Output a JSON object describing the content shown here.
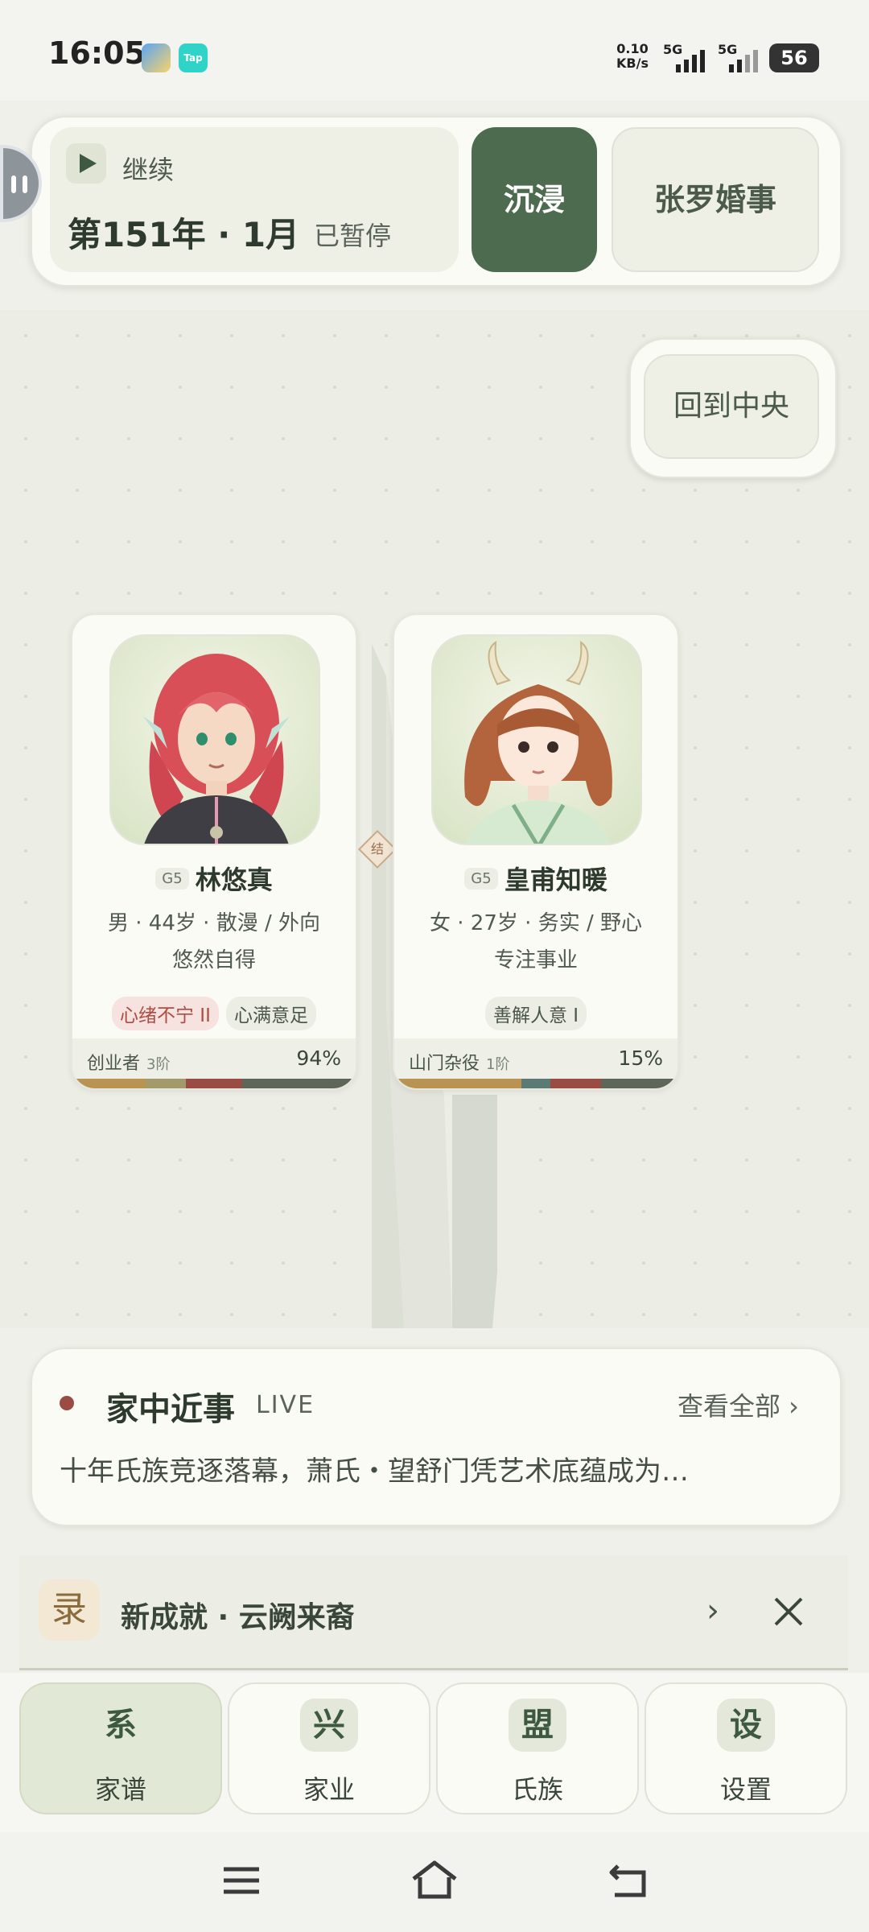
{
  "status_bar": {
    "time": "16:05",
    "app_icon_1": "Tap",
    "net_speed": "0.10",
    "net_unit": "KB/s",
    "sim1": "5G",
    "sim2": "5G",
    "battery": "56",
    "icons": [
      "app-icon-blue",
      "taptap-icon",
      "signal-icon",
      "battery-icon"
    ]
  },
  "top_bar": {
    "continue_label": "继续",
    "year_label": "第151年 · 1月",
    "paused_label": "已暂停",
    "immerse_button": "沉浸",
    "marriage_button": "张罗婚事"
  },
  "canvas": {
    "center_button": "回到中央",
    "marriage_knot": "结"
  },
  "members": [
    {
      "generation": "G5",
      "name": "林悠真",
      "info": "男 · 44岁 · 散漫 / 外向",
      "mood": "悠然自得",
      "tags": [
        {
          "label": "心绪不宁 II",
          "tone": "negative"
        },
        {
          "label": "心满意足",
          "tone": "neutral"
        }
      ],
      "job": "创业者",
      "job_level": "3阶",
      "progress": "94%",
      "progress_value": 0.94
    },
    {
      "generation": "G5",
      "name": "皇甫知暖",
      "info": "女 · 27岁 · 务实 / 野心",
      "mood": "专注事业",
      "tags": [
        {
          "label": "善解人意 I",
          "tone": "neutral"
        }
      ],
      "job": "山门杂役",
      "job_level": "1阶",
      "progress": "15%",
      "progress_value": 0.15
    }
  ],
  "news": {
    "title": "家中近事",
    "live": "LIVE",
    "view_all": "查看全部 ›",
    "text": "十年氏族竞逐落幕，萧氏・望舒门凭艺术底蕴成为…"
  },
  "achievement": {
    "icon_char": "录",
    "text": "新成就 · 云阙来裔",
    "arrow": "›"
  },
  "bottom_nav": [
    {
      "icon": "系",
      "label": "家谱",
      "active": true
    },
    {
      "icon": "兴",
      "label": "家业",
      "active": false
    },
    {
      "icon": "盟",
      "label": "氏族",
      "active": false
    },
    {
      "icon": "设",
      "label": "设置",
      "active": false
    }
  ],
  "colors": {
    "accent": "#4d6b4f",
    "background": "#eef0e9",
    "card": "#fbfbf6",
    "negative_tag": "#b04b43",
    "news_dot": "#9a4b43"
  }
}
